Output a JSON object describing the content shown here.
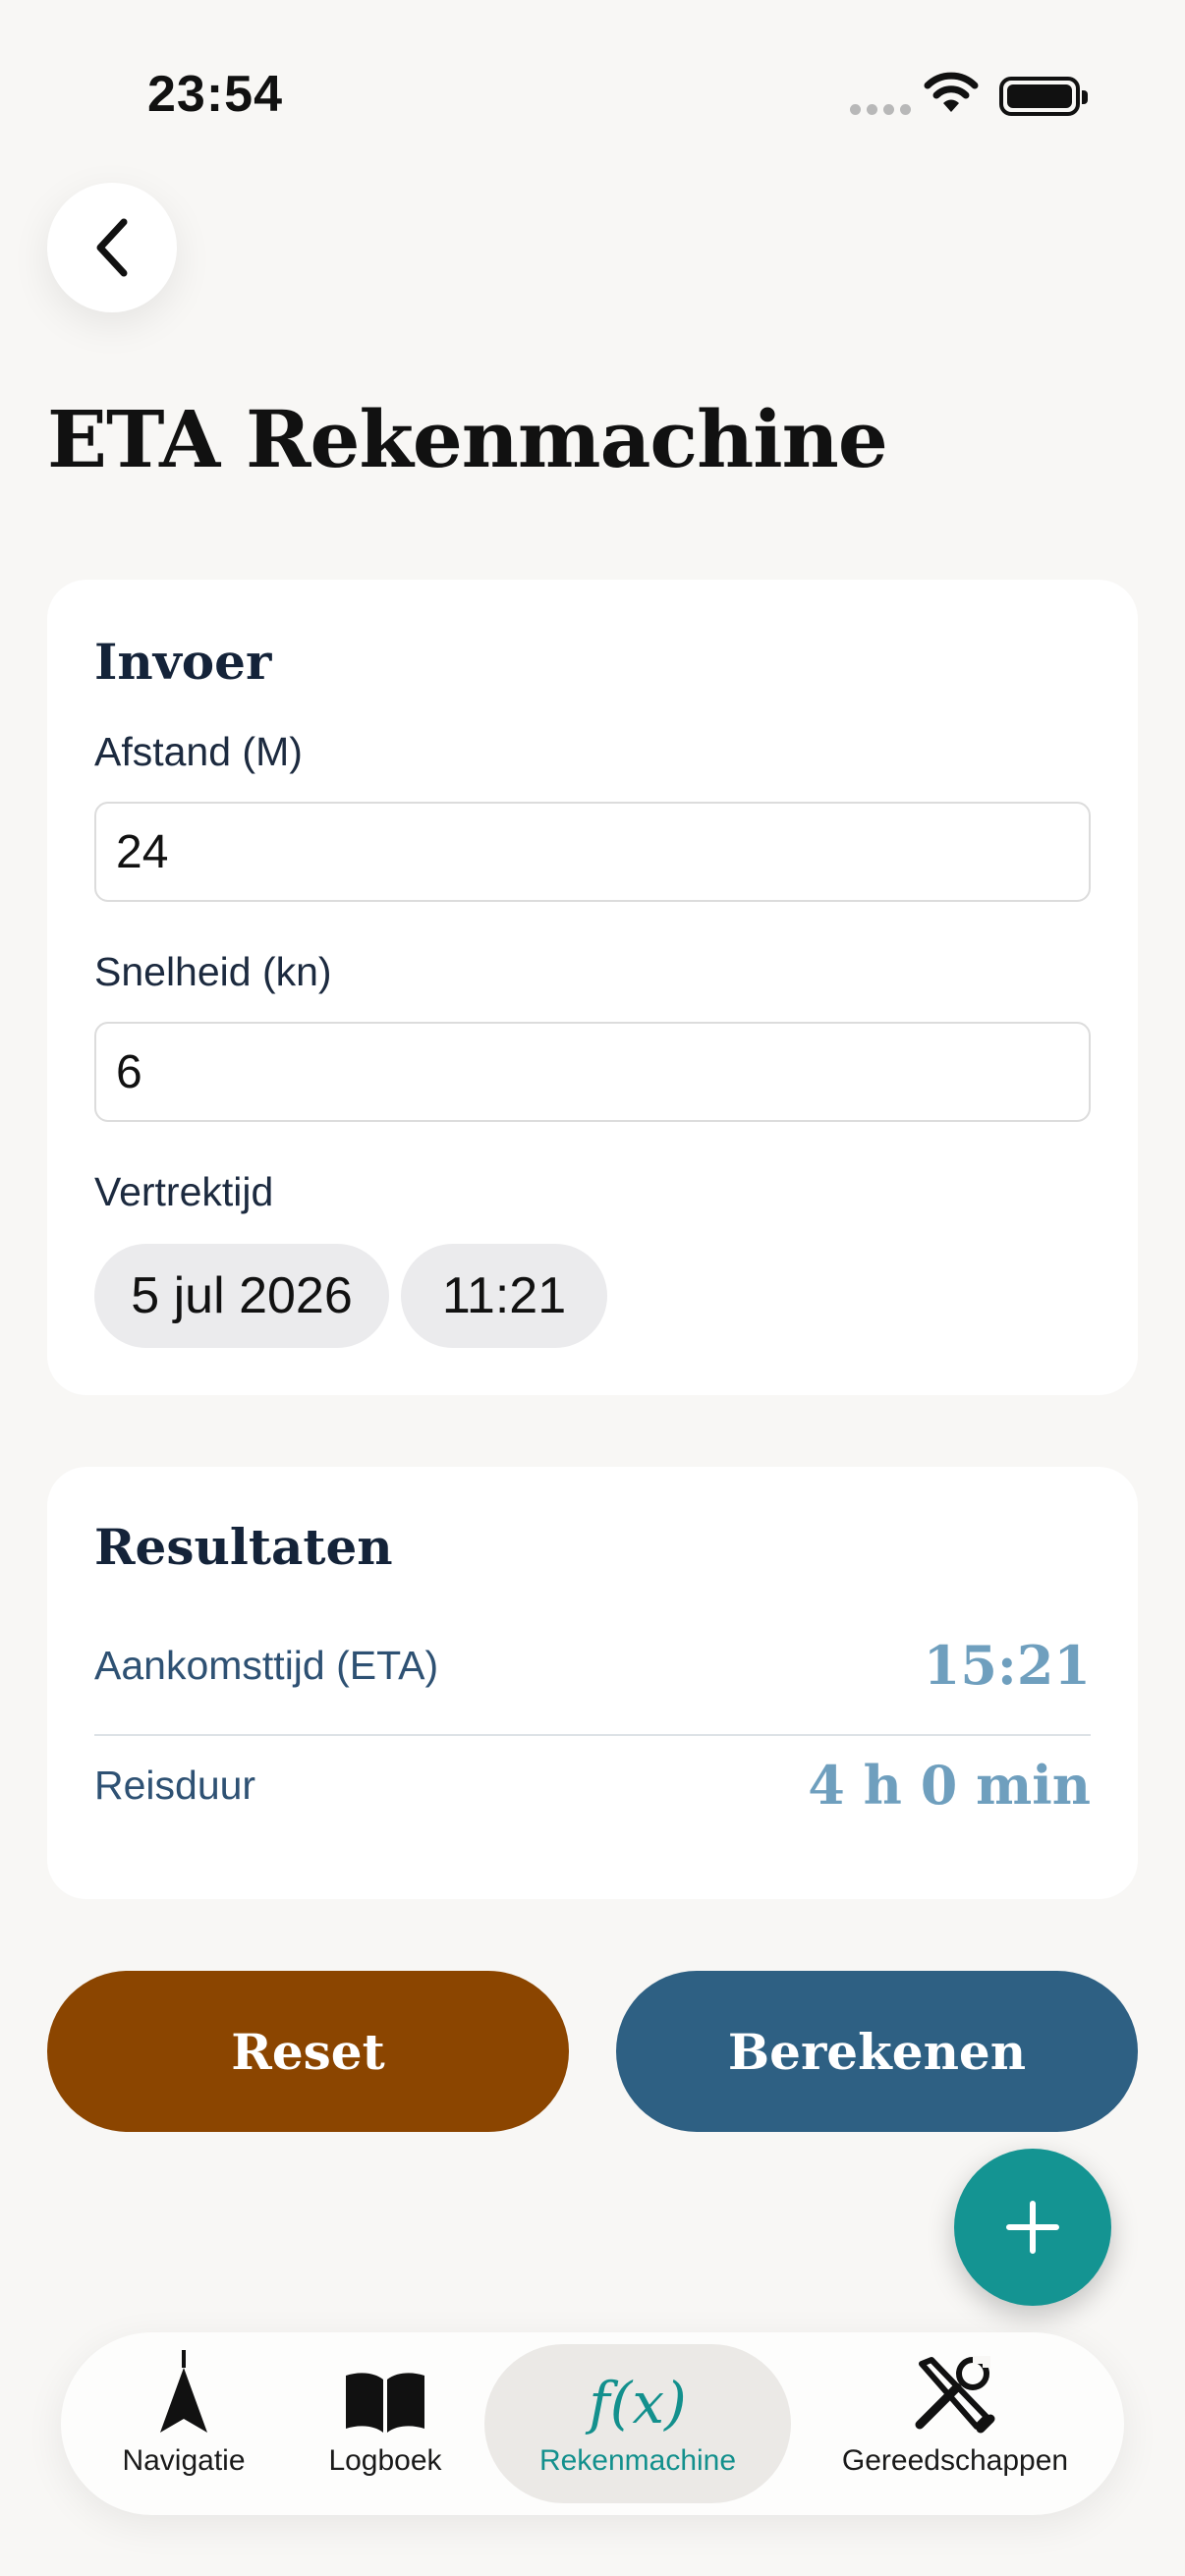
{
  "status_bar": {
    "time": "23:54"
  },
  "header": {
    "back_icon": "chevron-left-icon",
    "title": "ETA Rekenmachine"
  },
  "input_card": {
    "heading": "Invoer",
    "distance_label": "Afstand (M)",
    "distance_value": "24",
    "speed_label": "Snelheid (kn)",
    "speed_value": "6",
    "departure_label": "Vertrektijd",
    "departure_date": "5 jul 2026",
    "departure_time": "11:21"
  },
  "results_card": {
    "heading": "Resultaten",
    "eta_label": "Aankomsttijd (ETA)",
    "eta_value": "15:21",
    "duration_label": "Reisduur",
    "duration_value": "4 h 0 min"
  },
  "actions": {
    "reset_label": "Reset",
    "calculate_label": "Berekenen"
  },
  "fab": {
    "icon": "plus-icon"
  },
  "tab_bar": {
    "tabs": [
      {
        "label": "Navigatie",
        "icon": "navigation-arrow-icon",
        "active": false
      },
      {
        "label": "Logboek",
        "icon": "book-icon",
        "active": false
      },
      {
        "label": "Rekenmachine",
        "icon": "function-icon",
        "icon_text": "f(x)",
        "active": true
      },
      {
        "label": "Gereedschappen",
        "icon": "tools-icon",
        "active": false
      }
    ]
  },
  "colors": {
    "background": "#f8f7f5",
    "reset": "#8b4500",
    "calculate": "#2e6083",
    "accent": "#149492",
    "result_value": "#6f9fbe"
  }
}
